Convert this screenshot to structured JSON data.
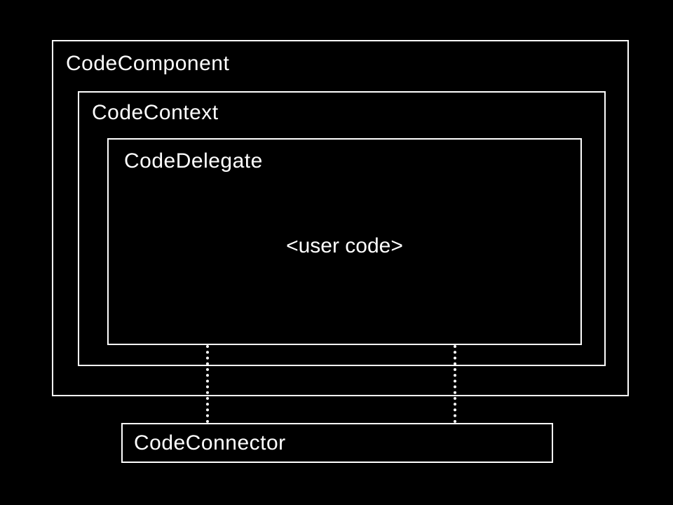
{
  "diagram": {
    "outer": {
      "label": "CodeComponent"
    },
    "context": {
      "label": "CodeContext"
    },
    "delegate": {
      "label": "CodeDelegate",
      "content": "<user code>"
    },
    "connector": {
      "label": "CodeConnector"
    }
  }
}
